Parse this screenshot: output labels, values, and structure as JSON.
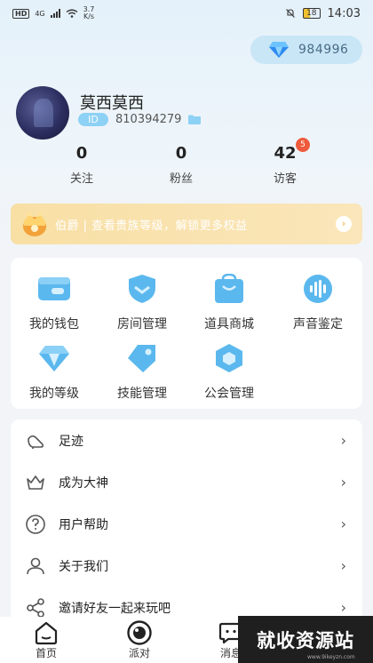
{
  "status_bar": {
    "network": "HD",
    "net_gen": "4G",
    "speed_value": "3.7",
    "speed_unit": "K/s",
    "battery": "18",
    "time": "14:03"
  },
  "diamond": {
    "icon": "diamond-icon",
    "count": "984996"
  },
  "profile": {
    "nickname": "莫西莫西",
    "id_label": "ID",
    "id_number": "810394279"
  },
  "stats": [
    {
      "value": "0",
      "label": "关注"
    },
    {
      "value": "0",
      "label": "粉丝"
    },
    {
      "value": "42",
      "label": "访客",
      "badge": "5"
    }
  ],
  "noble_banner": {
    "text": "伯爵 | 查看贵族等级，解锁更多权益"
  },
  "features": [
    {
      "label": "我的钱包",
      "icon": "wallet-icon"
    },
    {
      "label": "房间管理",
      "icon": "shield-icon"
    },
    {
      "label": "道具商城",
      "icon": "shopping-bag-icon"
    },
    {
      "label": "声音鉴定",
      "icon": "soundwave-icon"
    },
    {
      "label": "我的等级",
      "icon": "diamond-icon"
    },
    {
      "label": "技能管理",
      "icon": "tag-icon"
    },
    {
      "label": "公会管理",
      "icon": "hexagon-icon"
    }
  ],
  "menu": [
    {
      "label": "足迹",
      "icon": "footprint-icon"
    },
    {
      "label": "成为大神",
      "icon": "crown-icon"
    },
    {
      "label": "用户帮助",
      "icon": "help-icon"
    },
    {
      "label": "关于我们",
      "icon": "person-icon"
    },
    {
      "label": "邀请好友一起来玩吧",
      "icon": "share-icon"
    }
  ],
  "bottom_nav": [
    {
      "label": "首页",
      "icon": "home-icon"
    },
    {
      "label": "派对",
      "icon": "party-icon"
    },
    {
      "label": "消息",
      "icon": "message-icon"
    }
  ],
  "watermark": {
    "text": "就收资源站",
    "sub": "www.9ikeyzn.com"
  },
  "colors": {
    "accent_blue": "#5bb8ee",
    "badge_red": "#ee5a3c",
    "banner_gold": "#f8dfa4"
  }
}
